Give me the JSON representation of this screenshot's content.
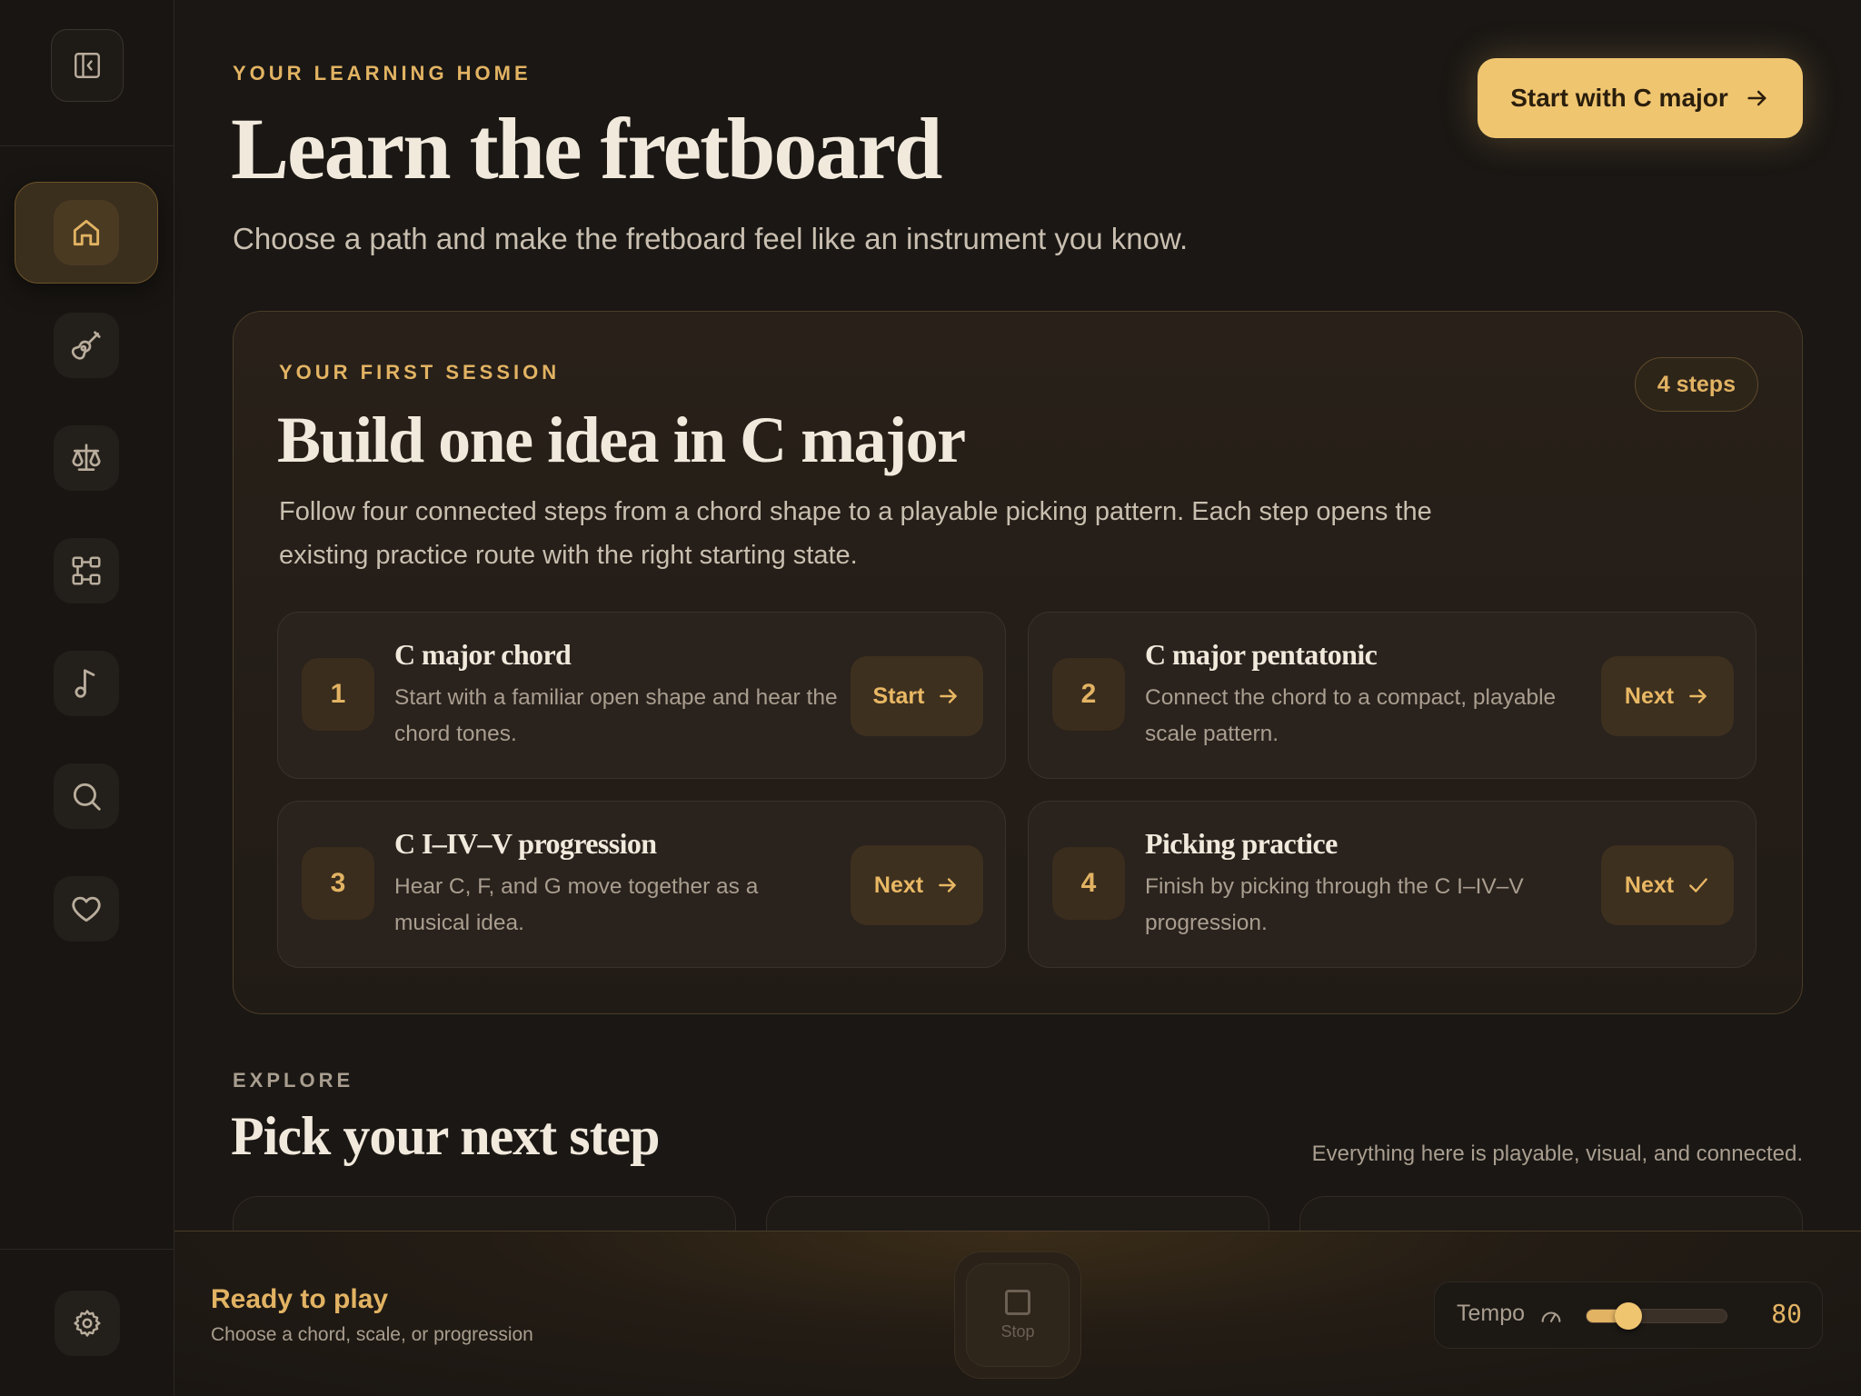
{
  "sidebar": {
    "toggle_icon": "sidebar-collapse-icon",
    "items": [
      {
        "name": "home",
        "icon": "home-icon",
        "active": true
      },
      {
        "name": "guitar",
        "icon": "guitar-icon",
        "active": false
      },
      {
        "name": "compare",
        "icon": "scale-icon",
        "active": false
      },
      {
        "name": "progressions",
        "icon": "flow-icon",
        "active": false
      },
      {
        "name": "music",
        "icon": "music-note-icon",
        "active": false
      },
      {
        "name": "search",
        "icon": "search-icon",
        "active": false
      },
      {
        "name": "favorites",
        "icon": "heart-icon",
        "active": false
      }
    ],
    "settings_icon": "gear-icon"
  },
  "header": {
    "eyebrow": "YOUR LEARNING HOME",
    "title": "Learn the fretboard",
    "subtitle": "Choose a path and make the fretboard feel like an instrument you know.",
    "cta_label": "Start with C major"
  },
  "session": {
    "eyebrow": "YOUR FIRST SESSION",
    "badge": "4 steps",
    "title": "Build one idea in C major",
    "description": "Follow four connected steps from a chord shape to a playable picking pattern. Each step opens the existing practice route with the right starting state.",
    "steps": [
      {
        "number": "1",
        "title": "C major chord",
        "description": "Start with a familiar open shape and hear the chord tones.",
        "button": "Start",
        "button_icon": "arrow-right-icon"
      },
      {
        "number": "2",
        "title": "C major pentatonic",
        "description": "Connect the chord to a compact, playable scale pattern.",
        "button": "Next",
        "button_icon": "arrow-right-icon"
      },
      {
        "number": "3",
        "title": "C I–IV–V progression",
        "description": "Hear C, F, and G move together as a musical idea.",
        "button": "Next",
        "button_icon": "arrow-right-icon"
      },
      {
        "number": "4",
        "title": "Picking practice",
        "description": "Finish by picking through the C I–IV–V progression.",
        "button": "Next",
        "button_icon": "check-icon"
      }
    ]
  },
  "explore": {
    "eyebrow": "EXPLORE",
    "title": "Pick your next step",
    "note": "Everything here is playable, visual, and connected."
  },
  "player": {
    "status_title": "Ready to play",
    "status_subtitle": "Choose a chord, scale, or progression",
    "stop_label": "Stop",
    "tempo_label": "Tempo",
    "tempo_value": "80",
    "tempo_fraction": 0.3
  },
  "colors": {
    "accent": "#e2b363",
    "cta": "#f0c570",
    "background": "#1a1714"
  }
}
